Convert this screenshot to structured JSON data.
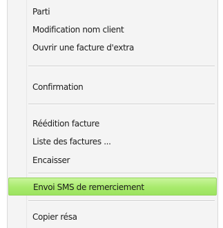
{
  "context_menu": {
    "items": [
      {
        "label": "Parti"
      },
      {
        "label": "Modification nom client"
      },
      {
        "label": "Ouvrir une facture d'extra"
      },
      {
        "label": "Confirmation"
      },
      {
        "label": "Réédition facture"
      },
      {
        "label": "Liste des factures ..."
      },
      {
        "label": "Encaisser"
      },
      {
        "label": "Envoi SMS de remerciement",
        "highlighted": true
      },
      {
        "label": "Copier résa"
      }
    ]
  },
  "colors": {
    "menu_background": "#f4f4f4",
    "highlight": "#a8ea6c",
    "text": "#1b1b1b",
    "separator": "#cfcfcf"
  }
}
